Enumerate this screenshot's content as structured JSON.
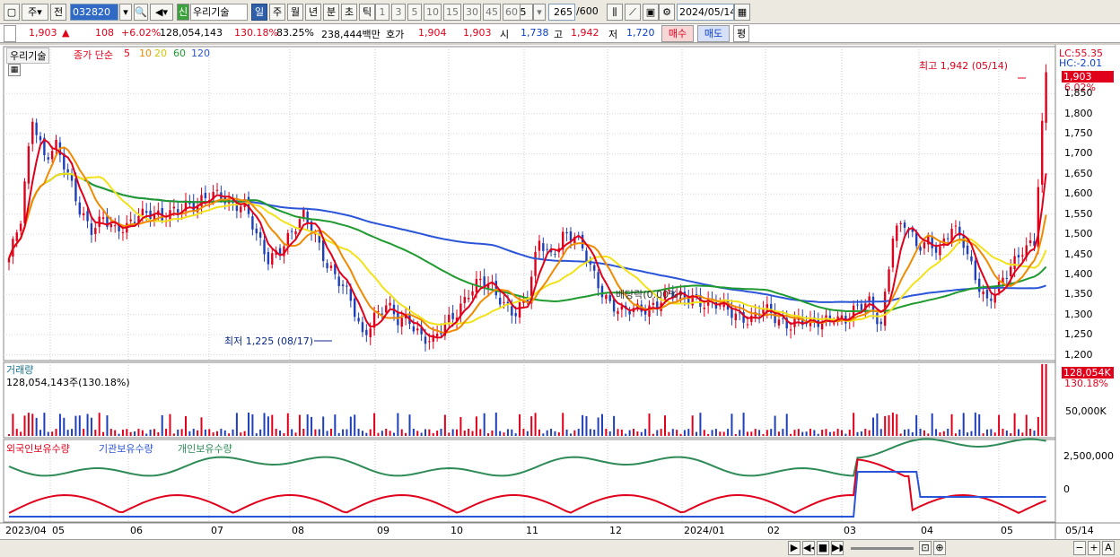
{
  "toolbar": {
    "type": "주",
    "prev": "전",
    "code": "032820",
    "stock_name": "우리기술",
    "new_tag": "신",
    "periods": [
      "일",
      "주",
      "월",
      "년",
      "분",
      "초",
      "틱"
    ],
    "selected_period": "일",
    "intervals": [
      "1",
      "3",
      "5",
      "10",
      "15",
      "30",
      "45",
      "60"
    ],
    "interval_value": "5",
    "count": "265",
    "count_total": "/600",
    "date": "2024/05/14"
  },
  "quote": {
    "price": "1,903",
    "arrow": "▲",
    "change": "108",
    "change_pct": "+6.02%",
    "volume": "128,054,143",
    "vol_ratio": "130.18%",
    "turnover": "83.25%",
    "amount": "238,444백만",
    "hoga_label": "호가",
    "ask": "1,904",
    "bid": "1,903",
    "open_label": "시",
    "open": "1,738",
    "high_label": "고",
    "high": "1,942",
    "low_label": "저",
    "low": "1,720",
    "buy": "매수",
    "sell": "매도",
    "avg": "평"
  },
  "legend": {
    "name": "우리기술",
    "prefix": "종가 단순",
    "ma": [
      "5",
      "10",
      "20",
      "60",
      "120"
    ]
  },
  "colors": {
    "ma5": "#e1001b",
    "ma10": "#f08a00",
    "ma20": "#f2e21a",
    "ma60": "#1f9a2f",
    "ma120": "#2a55d8",
    "up": "#e1001b",
    "down": "#1f3fb8",
    "foreign": "#e1001b",
    "inst": "#2a55d8",
    "indiv": "#2e8b57"
  },
  "right_axis": {
    "lc": "LC:55.35",
    "hc": "HC:-2.01",
    "last": "1,903",
    "last_pct": "6.02%",
    "ticks": [
      "1,850",
      "1,800",
      "1,750",
      "1,700",
      "1,650",
      "1,600",
      "1,550",
      "1,500",
      "1,450",
      "1,400",
      "1,350",
      "1,300",
      "1,250",
      "1,200"
    ],
    "vol_last": "128,054K",
    "vol_pct": "130.18%",
    "vol_tick": "50,000K",
    "hold_ticks": [
      "2,500,000",
      "0"
    ]
  },
  "annot": {
    "high": "최고 1,942 (05/14)",
    "low": "최저 1,225 (08/17)",
    "ex": "배당락(0.00%)"
  },
  "volume_panel": {
    "title": "거래량",
    "info": "128,054,143주(130.18%)"
  },
  "holding_panel": {
    "legend": [
      "외국인보유수량",
      "기관보유수량",
      "개인보유수량"
    ]
  },
  "xaxis": {
    "labels": [
      "2023/04",
      "05",
      "06",
      "07",
      "08",
      "09",
      "10",
      "11",
      "12",
      "2024/01",
      "02",
      "03",
      "04",
      "05"
    ],
    "right": "05/14"
  },
  "chart_data": {
    "type": "candlestick",
    "y_range": [
      1190,
      1960
    ],
    "close": [
      1440,
      1530,
      1790,
      1700,
      1720,
      1640,
      1560,
      1520,
      1540,
      1500,
      1520,
      1560,
      1550,
      1530,
      1560,
      1580,
      1570,
      1590,
      1600,
      1580,
      1570,
      1490,
      1440,
      1470,
      1500,
      1540,
      1500,
      1430,
      1380,
      1330,
      1250,
      1300,
      1320,
      1280,
      1290,
      1250,
      1230,
      1270,
      1310,
      1360,
      1380,
      1360,
      1330,
      1310,
      1340,
      1480,
      1450,
      1500,
      1490,
      1440,
      1380,
      1330,
      1300,
      1310,
      1320,
      1330,
      1350,
      1340,
      1350,
      1330,
      1320,
      1310,
      1300,
      1290,
      1310,
      1290,
      1280,
      1290,
      1270,
      1280,
      1300,
      1290,
      1310,
      1330,
      1280,
      1500,
      1520,
      1470,
      1490,
      1460,
      1510,
      1480,
      1400,
      1330,
      1360,
      1420,
      1470,
      1480,
      1903
    ]
  }
}
